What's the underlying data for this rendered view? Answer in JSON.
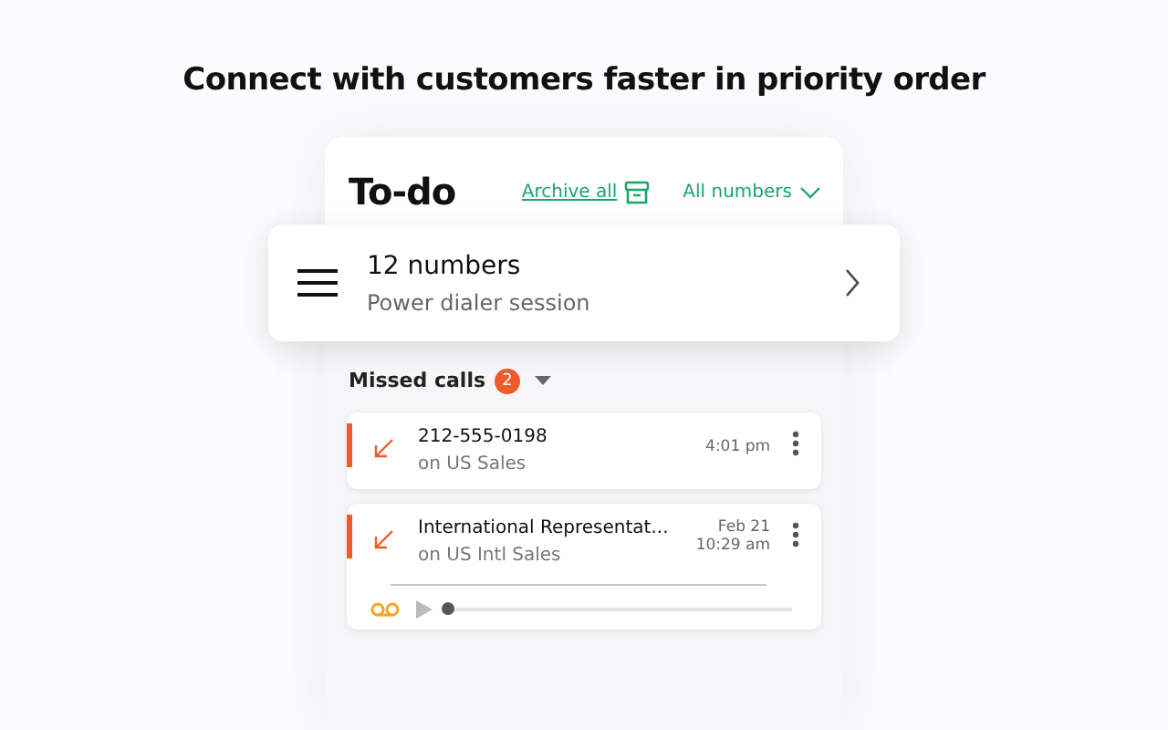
{
  "headline": "Connect with customers faster in priority order",
  "panel": {
    "title": "To-do",
    "archive_link": "Archive all",
    "filter": "All numbers"
  },
  "session": {
    "title": "12 numbers",
    "subtitle": "Power dialer session"
  },
  "section": {
    "title": "Missed calls",
    "count": "2",
    "expanded": true
  },
  "calls": [
    {
      "kind": "call",
      "name": "212-555-0198",
      "line": "on US Sales",
      "time": [
        "4:01 pm"
      ]
    },
    {
      "kind": "voicemail",
      "name": "International Representat...",
      "line": "on US Intl Sales",
      "time": [
        "Feb 21",
        "10:29 am"
      ],
      "level": 0
    }
  ]
}
